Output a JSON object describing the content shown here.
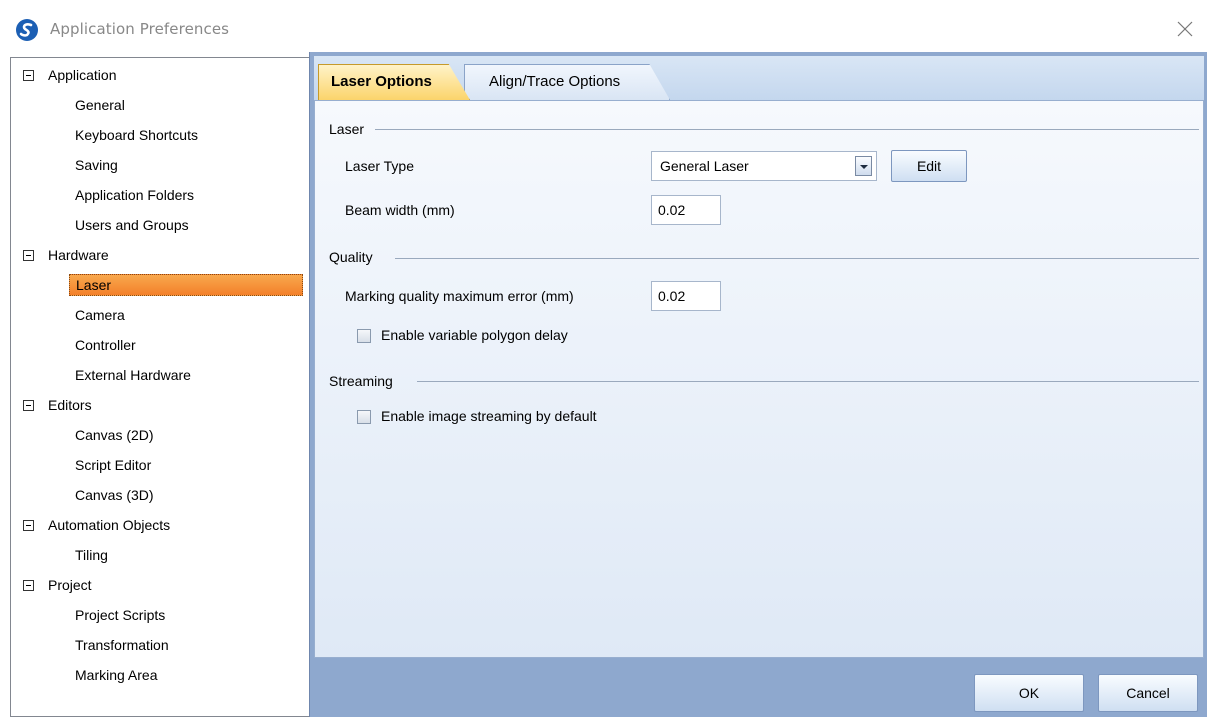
{
  "window": {
    "title": "Application Preferences",
    "logo_icon": "app-logo-icon",
    "close_icon": "close-icon"
  },
  "tree": {
    "groups": [
      {
        "label": "Application",
        "children": [
          "General",
          "Keyboard Shortcuts",
          "Saving",
          "Application Folders",
          "Users and Groups"
        ]
      },
      {
        "label": "Hardware",
        "children": [
          "Laser",
          "Camera",
          "Controller",
          "External Hardware"
        ]
      },
      {
        "label": "Editors",
        "children": [
          "Canvas (2D)",
          "Script Editor",
          "Canvas (3D)"
        ]
      },
      {
        "label": "Automation Objects",
        "children": [
          "Tiling"
        ]
      },
      {
        "label": "Project",
        "children": [
          "Project Scripts",
          "Transformation",
          "Marking Area"
        ]
      }
    ],
    "selected": "Laser"
  },
  "tabs": {
    "laser": "Laser Options",
    "align": "Align/Trace Options",
    "active": "Laser Options"
  },
  "laser_group": {
    "header": "Laser",
    "laser_type_label": "Laser Type",
    "laser_type_value": "General Laser",
    "edit_label": "Edit",
    "beam_width_label": "Beam width (mm)",
    "beam_width_value": "0.02"
  },
  "quality_group": {
    "header": "Quality",
    "max_error_label": "Marking quality maximum error (mm)",
    "max_error_value": "0.02",
    "variable_delay_label": "Enable variable polygon delay",
    "variable_delay_checked": false
  },
  "streaming_group": {
    "header": "Streaming",
    "image_streaming_label": "Enable image streaming by default",
    "image_streaming_checked": false
  },
  "footer": {
    "ok_label": "OK",
    "cancel_label": "Cancel"
  },
  "colors": {
    "selection_orange": "#f3802a",
    "active_tab": "#fbd46b",
    "panel_blue": "#8ea8ce"
  }
}
